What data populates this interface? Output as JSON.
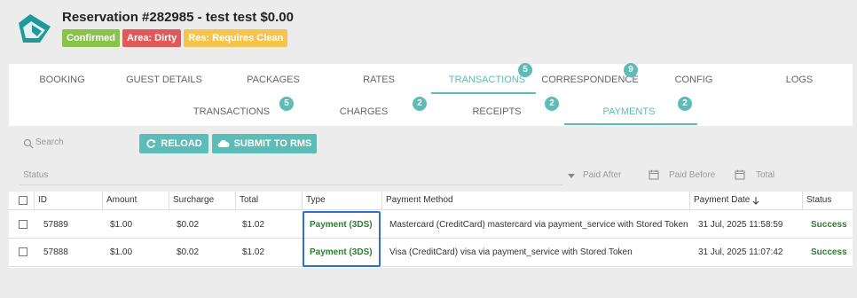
{
  "reservation": {
    "title": "Reservation #282985 - test test $0.00",
    "badges": [
      {
        "label": "Confirmed",
        "color": "#8bc34a"
      },
      {
        "label": "Area: Dirty",
        "color": "#e05a5a"
      },
      {
        "label": "Res: Requires Clean",
        "color": "#f6c34d"
      }
    ]
  },
  "tabs": {
    "primary": [
      {
        "label": "BOOKING"
      },
      {
        "label": "GUEST DETAILS"
      },
      {
        "label": "PACKAGES"
      },
      {
        "label": "RATES"
      },
      {
        "label": "TRANSACTIONS",
        "badge": "5",
        "active": true
      },
      {
        "label": "CORRESPONDENCE",
        "badge": "9"
      },
      {
        "label": "CONFIG"
      },
      {
        "label": "LOGS"
      }
    ],
    "secondary": [
      {
        "label": "TRANSACTIONS",
        "badge": "5"
      },
      {
        "label": "CHARGES",
        "badge": "2"
      },
      {
        "label": "RECEIPTS",
        "badge": "2"
      },
      {
        "label": "PAYMENTS",
        "badge": "2",
        "active": true
      }
    ]
  },
  "toolbar": {
    "search_placeholder": "Search",
    "reload_label": "RELOAD",
    "submit_label": "SUBMIT TO RMS"
  },
  "filters": {
    "status_label": "Status",
    "paid_after": "Paid After",
    "paid_before": "Paid Before",
    "total": "Total"
  },
  "table": {
    "headers": [
      "ID",
      "Amount",
      "Surcharge",
      "Total",
      "Type",
      "Payment Method",
      "Payment Date",
      "Status"
    ],
    "rows": [
      {
        "id": "57889",
        "amount": "$1.00",
        "surcharge": "$0.02",
        "total": "$1.02",
        "type": "Payment (3DS)",
        "method": "Mastercard (CreditCard) mastercard via payment_service with Stored Token",
        "date": "31 Jul, 2025 11:58:59",
        "status": "Success"
      },
      {
        "id": "57888",
        "amount": "$1.00",
        "surcharge": "$0.02",
        "total": "$1.02",
        "type": "Payment (3DS)",
        "method": "Visa (CreditCard) visa via payment_service with Stored Token",
        "date": "31 Jul, 2025 11:07:42",
        "status": "Success"
      }
    ]
  },
  "colors": {
    "accent": "#5bbcb8",
    "success": "#2e7d32",
    "highlight": "#2d6fd6"
  }
}
